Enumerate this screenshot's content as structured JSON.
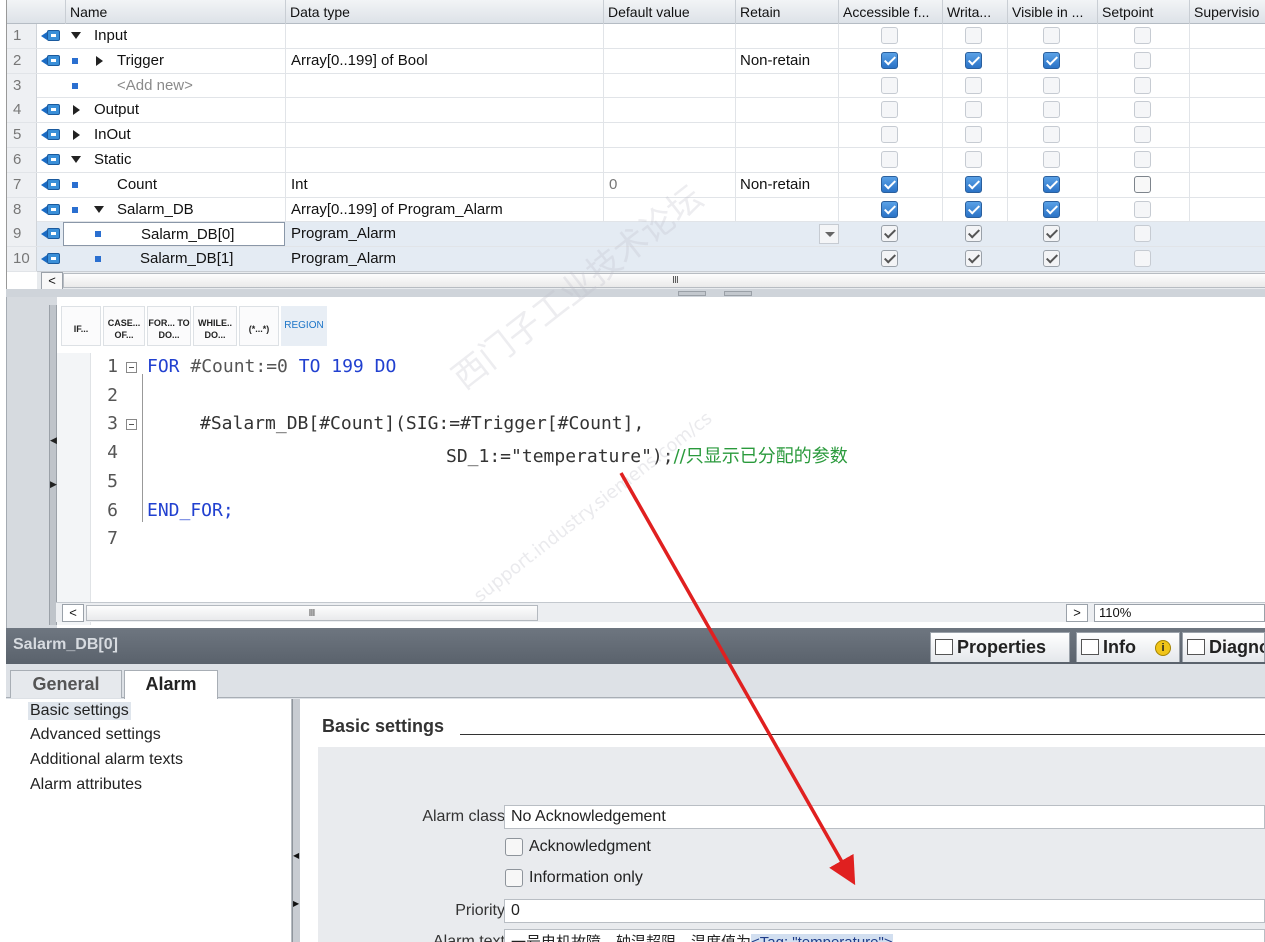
{
  "table": {
    "columns": [
      "Name",
      "Data type",
      "Default value",
      "Retain",
      "Accessible f...",
      "Writa...",
      "Visible in ...",
      "Setpoint",
      "Supervisio"
    ],
    "rows": [
      {
        "n": "1",
        "name": "Input",
        "type": "",
        "def": "",
        "retain": ""
      },
      {
        "n": "2",
        "name": "Trigger",
        "type": "Array[0..199] of Bool",
        "def": "",
        "retain": "Non-retain"
      },
      {
        "n": "3",
        "name": "<Add new>",
        "type": "",
        "def": "",
        "retain": ""
      },
      {
        "n": "4",
        "name": "Output",
        "type": "",
        "def": "",
        "retain": ""
      },
      {
        "n": "5",
        "name": "InOut",
        "type": "",
        "def": "",
        "retain": ""
      },
      {
        "n": "6",
        "name": "Static",
        "type": "",
        "def": "",
        "retain": ""
      },
      {
        "n": "7",
        "name": "Count",
        "type": "Int",
        "def": "0",
        "retain": "Non-retain"
      },
      {
        "n": "8",
        "name": "Salarm_DB",
        "type": "Array[0..199] of Program_Alarm",
        "def": "",
        "retain": ""
      },
      {
        "n": "9",
        "name": "Salarm_DB[0]",
        "type": "Program_Alarm",
        "def": "",
        "retain": ""
      },
      {
        "n": "10",
        "name": "Salarm_DB[1]",
        "type": "Program_Alarm",
        "def": "",
        "retain": ""
      }
    ],
    "scroll_glyph": "Ⅲ"
  },
  "toolbar": {
    "if": "IF...",
    "case": "CASE... OF...",
    "for": "FOR... TO DO...",
    "while": "WHILE.. DO...",
    "comment": "(*...*)",
    "region": "REGION"
  },
  "code": {
    "line_numbers": [
      "1",
      "2",
      "3",
      "4",
      "5",
      "6",
      "7"
    ],
    "l1_for": "FOR",
    "l1_var": " #Count:=0 ",
    "l1_to": "TO",
    "l1_num": " 199 ",
    "l1_do": "DO",
    "l3": "#Salarm_DB[#Count](SIG:=#Trigger[#Count],",
    "l4a": "SD_1:=\"temperature\");",
    "l4b": "//只显示已分配的参数",
    "l6": "END_FOR;",
    "zoom": "110%",
    "scroll_glyph": "Ⅲ"
  },
  "watermark": {
    "line1": "西门子工业技术论坛",
    "line2": "support.industry.siemens.com/cs"
  },
  "props": {
    "title": "Salarm_DB[0]",
    "tab_properties": "Properties",
    "tab_info": "Info",
    "tab_info_badge": "i",
    "tab_diag": "Diagno",
    "subtab_general": "General",
    "subtab_alarm": "Alarm",
    "nav": [
      "Basic settings",
      "Advanced settings",
      "Additional alarm texts",
      "Alarm attributes"
    ],
    "section_title": "Basic settings",
    "alarm_class_label": "Alarm class",
    "alarm_class_value": "No Acknowledgement",
    "ack_label": "Acknowledgment",
    "info_only_label": "Information only",
    "priority_label": "Priority",
    "priority_value": "0",
    "alarm_text_label": "Alarm text",
    "alarm_text_value": "一号电机故障，轴温超限，温度值为",
    "alarm_text_tag": "<Tag: \"temperature\">"
  },
  "colors": {
    "keyword": "#2140d0",
    "comment": "#2a9a3c",
    "arrow": "#e02020",
    "checkbox_blue": "#2a72c6"
  }
}
